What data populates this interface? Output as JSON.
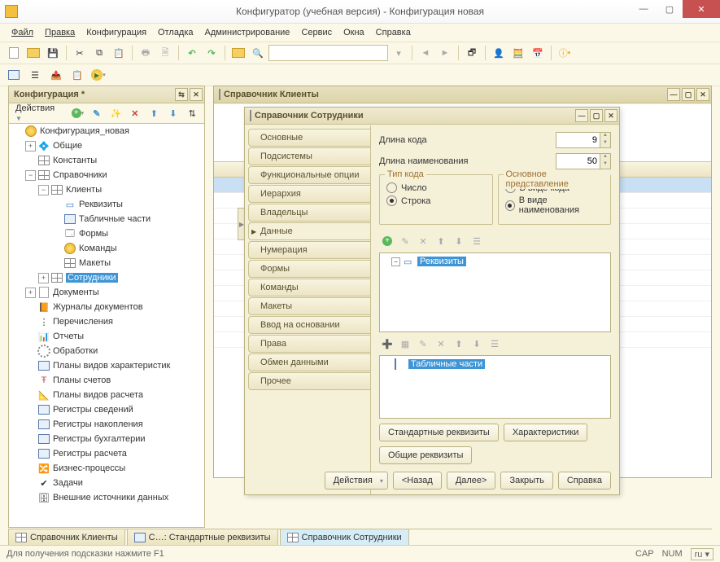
{
  "window": {
    "title": "Конфигуратор (учебная версия) - Конфигурация новая"
  },
  "menu": [
    "Файл",
    "Правка",
    "Конфигурация",
    "Отладка",
    "Администрирование",
    "Сервис",
    "Окна",
    "Справка"
  ],
  "config_panel": {
    "title": "Конфигурация *",
    "actions_label": "Действия",
    "root": "Конфигурация_новая",
    "items": {
      "common": "Общие",
      "constants": "Константы",
      "catalogs": "Справочники",
      "clients": "Клиенты",
      "requisites": "Реквизиты",
      "tabular": "Табличные части",
      "forms": "Формы",
      "commands": "Команды",
      "layouts": "Макеты",
      "employees": "Сотрудники",
      "documents": "Документы",
      "journals": "Журналы документов",
      "enums": "Перечисления",
      "reports": "Отчеты",
      "processing": "Обработки",
      "char_plans": "Планы видов характеристик",
      "acc_plans": "Планы счетов",
      "calc_plans": "Планы видов расчета",
      "info_reg": "Регистры сведений",
      "acc_reg": "Регистры накопления",
      "book_reg": "Регистры бухгалтерии",
      "calc_reg": "Регистры расчета",
      "bp": "Бизнес-процессы",
      "tasks": "Задачи",
      "ext": "Внешние источники данных"
    }
  },
  "back_window": {
    "title": "Справочник Клиенты"
  },
  "front_window": {
    "title": "Справочник Сотрудники",
    "tabs": [
      "Основные",
      "Подсистемы",
      "Функциональные опции",
      "Иерархия",
      "Владельцы",
      "Данные",
      "Нумерация",
      "Формы",
      "Команды",
      "Макеты",
      "Ввод на основании",
      "Права",
      "Обмен данными",
      "Прочее"
    ],
    "active_tab": "Данные",
    "form": {
      "code_len_label": "Длина кода",
      "code_len_value": "9",
      "name_len_label": "Длина наименования",
      "name_len_value": "50",
      "type_legend": "Тип кода",
      "type_number": "Число",
      "type_string": "Строка",
      "repr_legend": "Основное представление",
      "repr_code": "В виде кода",
      "repr_name": "В виде наименования",
      "list1_item": "Реквизиты",
      "list2_item": "Табличные части",
      "btn_std_req": "Стандартные реквизиты",
      "btn_char": "Характеристики",
      "btn_common_req": "Общие реквизиты",
      "btn_actions": "Действия",
      "btn_back": "<Назад",
      "btn_next": "Далее>",
      "btn_close": "Закрыть",
      "btn_help": "Справка"
    }
  },
  "bottom_tabs": {
    "t1": "Справочник Клиенты",
    "t2": "С…: Стандартные реквизиты",
    "t3": "Справочник Сотрудники"
  },
  "statusbar": {
    "hint": "Для получения подсказки нажмите F1",
    "cap": "CAP",
    "num": "NUM",
    "lang": "ru"
  }
}
